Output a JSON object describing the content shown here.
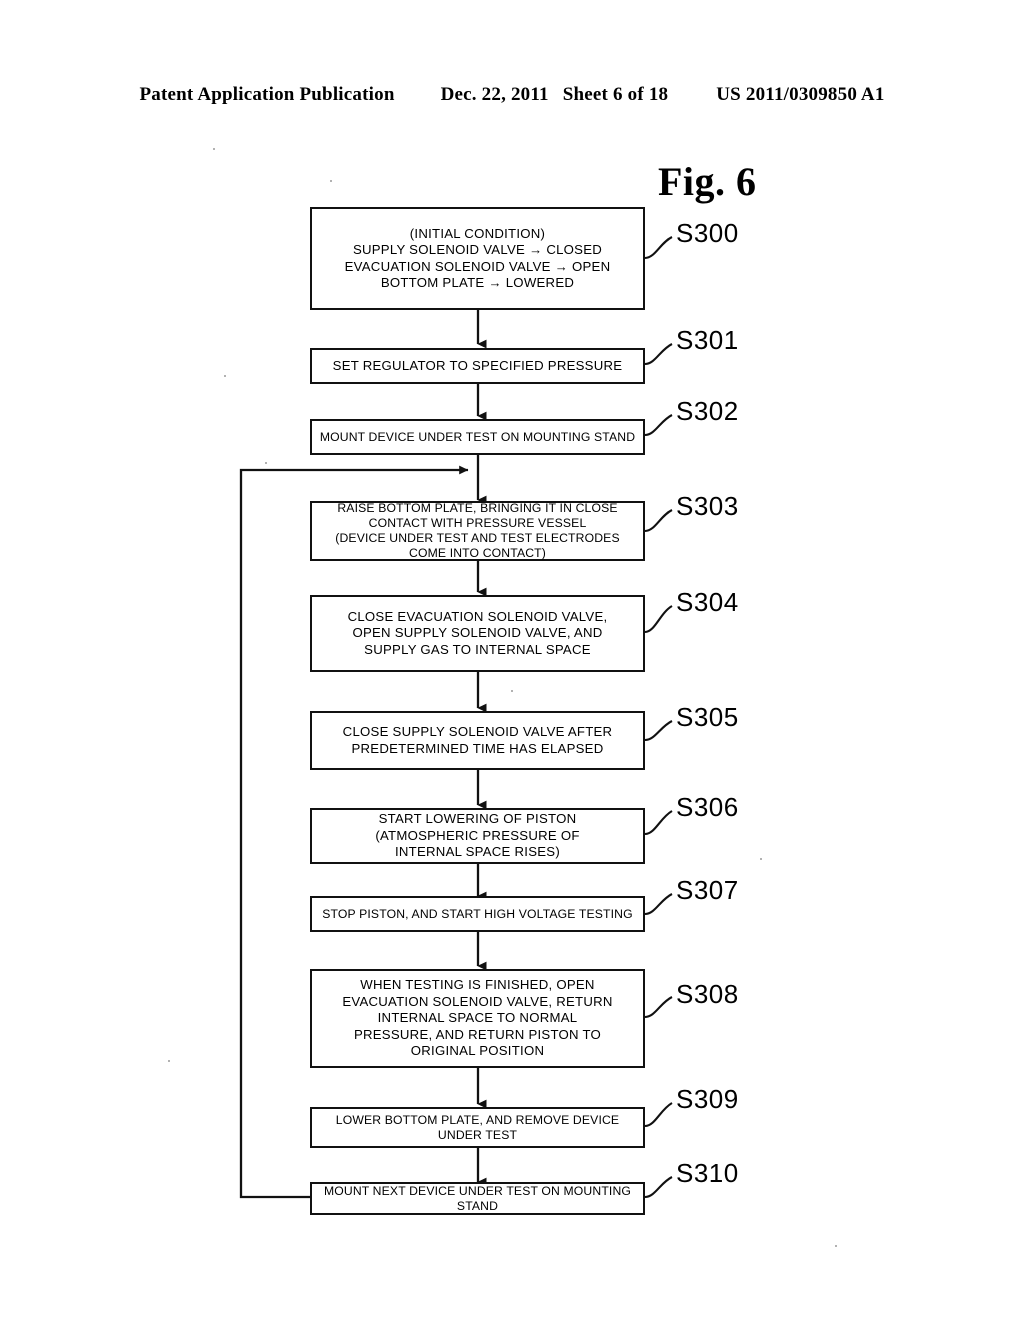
{
  "page_header": {
    "publication": "Patent Application Publication",
    "date": "Dec. 22, 2011",
    "sheet": "Sheet 6 of 18",
    "patent_number": "US 2011/0309850 A1"
  },
  "figure": {
    "title": "Fig. 6",
    "type": "flowchart",
    "loop": {
      "from_step": "S310",
      "to_step": "S303",
      "description": "Return loop from S310 left edge back into the connector above S303"
    },
    "steps": [
      {
        "id": "S300",
        "label": "S300",
        "text": "(INITIAL CONDITION)\nSUPPLY SOLENOID VALVE → CLOSED\nEVACUATION SOLENOID VALVE → OPEN\nBOTTOM PLATE → LOWERED",
        "size": "normal"
      },
      {
        "id": "S301",
        "label": "S301",
        "text": "SET REGULATOR TO SPECIFIED PRESSURE",
        "size": "normal"
      },
      {
        "id": "S302",
        "label": "S302",
        "text": "MOUNT DEVICE UNDER TEST ON MOUNTING STAND",
        "size": "small"
      },
      {
        "id": "S303",
        "label": "S303",
        "text": "RAISE BOTTOM PLATE, BRINGING IT IN CLOSE\nCONTACT WITH PRESSURE VESSEL\n(DEVICE UNDER TEST AND TEST ELECTRODES\nCOME INTO CONTACT)",
        "size": "small"
      },
      {
        "id": "S304",
        "label": "S304",
        "text": "CLOSE EVACUATION SOLENOID VALVE,\nOPEN SUPPLY SOLENOID VALVE, AND\nSUPPLY GAS TO INTERNAL SPACE",
        "size": "normal"
      },
      {
        "id": "S305",
        "label": "S305",
        "text": "CLOSE SUPPLY SOLENOID VALVE AFTER\nPREDETERMINED TIME HAS ELAPSED",
        "size": "normal"
      },
      {
        "id": "S306",
        "label": "S306",
        "text": "START LOWERING OF PISTON\n(ATMOSPHERIC PRESSURE OF\nINTERNAL SPACE RISES)",
        "size": "normal"
      },
      {
        "id": "S307",
        "label": "S307",
        "text": "STOP PISTON, AND START HIGH VOLTAGE TESTING",
        "size": "small"
      },
      {
        "id": "S308",
        "label": "S308",
        "text": "WHEN TESTING IS FINISHED, OPEN\nEVACUATION SOLENOID VALVE, RETURN\nINTERNAL SPACE TO NORMAL\nPRESSURE, AND RETURN PISTON TO\nORIGINAL POSITION",
        "size": "normal"
      },
      {
        "id": "S309",
        "label": "S309",
        "text": "LOWER BOTTOM PLATE, AND REMOVE DEVICE\nUNDER TEST",
        "size": "small"
      },
      {
        "id": "S310",
        "label": "S310",
        "text": "MOUNT NEXT DEVICE UNDER TEST ON MOUNTING STAND",
        "size": "small"
      }
    ]
  },
  "colors": {
    "ink": "#111111",
    "paper": "#ffffff"
  }
}
